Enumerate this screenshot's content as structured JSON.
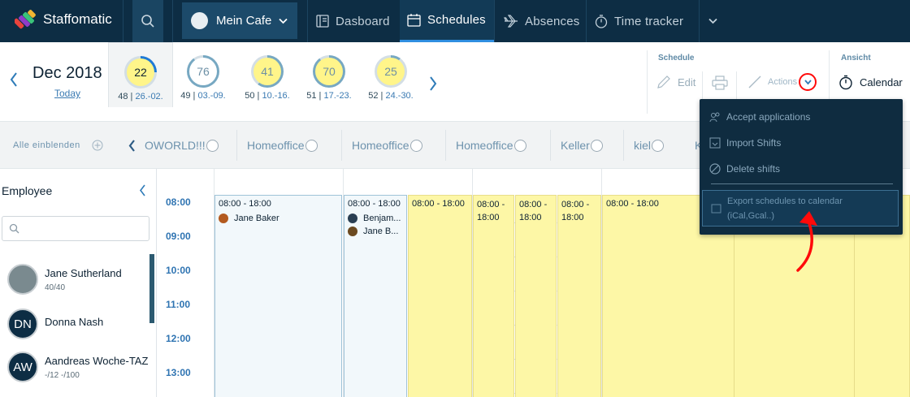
{
  "nav": {
    "logo_text": "Staffomatic",
    "location": "Mein Cafe",
    "items": [
      {
        "label": "Dasboard",
        "icon": "dashboard-icon",
        "active": false
      },
      {
        "label": "Schedules",
        "icon": "schedules-icon",
        "active": true
      },
      {
        "label": "Absences",
        "icon": "airplane-icon",
        "active": false
      },
      {
        "label": "Time tracker",
        "icon": "stopwatch-icon",
        "active": false
      }
    ],
    "accent_color": "#2f8ee0",
    "bg_color": "#0d2d44"
  },
  "weekbar": {
    "month": "Dec 2018",
    "today_label": "Today",
    "weeks": [
      {
        "count": "22",
        "week": "48",
        "range": "26.-02.",
        "progress": 0.25,
        "selected": true
      },
      {
        "count": "76",
        "week": "49",
        "range": "03.-09.",
        "progress": 0.9,
        "selected": false
      },
      {
        "count": "41",
        "week": "50",
        "range": "10.-16.",
        "progress": 0.6,
        "selected": false
      },
      {
        "count": "70",
        "week": "51",
        "range": "17.-23.",
        "progress": 0.9,
        "selected": false
      },
      {
        "count": "25",
        "week": "52",
        "range": "24.-30.",
        "progress": 0.1,
        "selected": false
      }
    ],
    "schedule_group": {
      "label": "Schedule",
      "edit": "Edit",
      "actions": "Actions"
    },
    "ansicht_group": {
      "label": "Ansicht",
      "view": "Calendar"
    }
  },
  "filterbar": {
    "show_all": "Alle einblenden",
    "filters": [
      "OWORLD!!!",
      "Homeoffice",
      "Homeoffice",
      "Homeoffice",
      "Keller",
      "kiel",
      "K"
    ]
  },
  "employees": {
    "header": "Employee",
    "search_placeholder": "",
    "list": [
      {
        "name": "Jane Sutherland",
        "sub": "40/40",
        "initials": "",
        "avatar_color": "#7a8a8f"
      },
      {
        "name": "Donna Nash",
        "sub": "",
        "initials": "DN",
        "avatar_color": "#0d2d44"
      },
      {
        "name": "Aandreas Woche-TAZ",
        "sub": "-/12 -/100",
        "initials": "AW",
        "avatar_color": "#0d2d44"
      }
    ]
  },
  "calendar": {
    "times": [
      "08:00",
      "09:00",
      "10:00",
      "11:00",
      "12:00",
      "13:00"
    ],
    "shifts": [
      {
        "time": "08:00 - 18:00",
        "people": [
          "Jane Baker"
        ]
      },
      {
        "time": "08:00 - 18:00",
        "people": [
          "Benjam...",
          "Jane B..."
        ]
      },
      {
        "time": "08:00 - 18:00",
        "people": []
      },
      {
        "time": "08:00 - 18:00",
        "people": []
      },
      {
        "time": "08:00 - 18:00",
        "people": []
      },
      {
        "time": "08:00 - 18:00",
        "people": []
      },
      {
        "time": "08:00 - 18:00",
        "people": []
      }
    ],
    "shift_color": "#fdf7a6"
  },
  "dropdown": {
    "items": [
      {
        "label": "Accept applications",
        "icon": "users-icon"
      },
      {
        "label": "Import Shifts",
        "icon": "import-icon"
      },
      {
        "label": "Delete shifts",
        "icon": "ban-icon"
      }
    ],
    "export_line1": "Export schedules to calendar",
    "export_line2": "(iCal,Gcal..)"
  }
}
